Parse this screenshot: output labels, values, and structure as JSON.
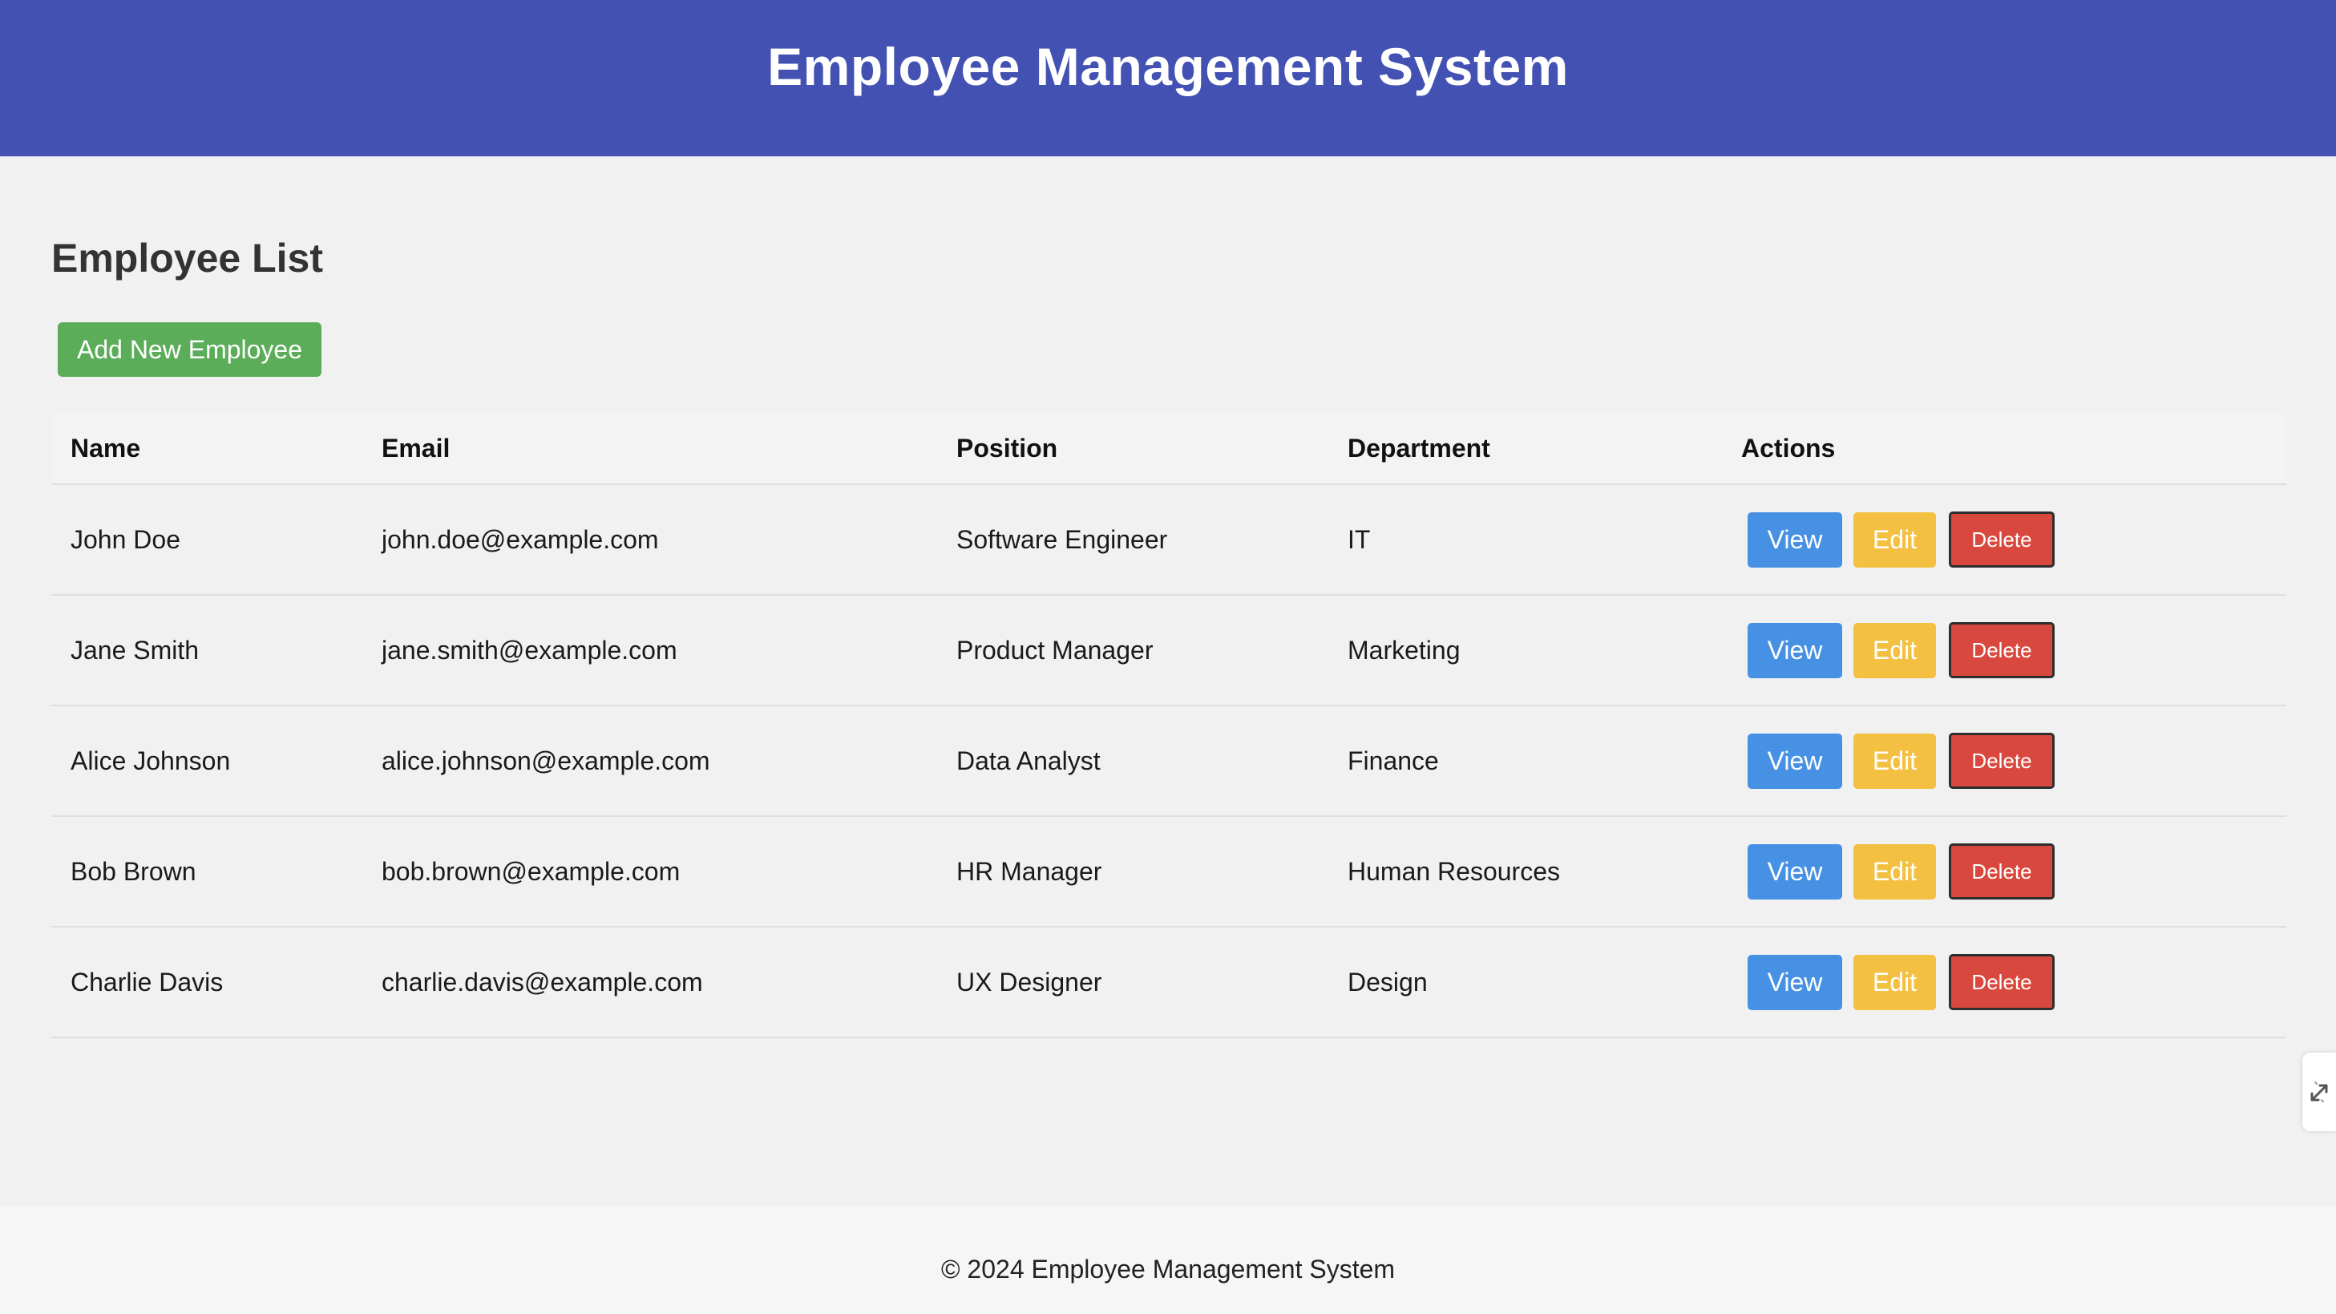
{
  "header": {
    "title": "Employee Management System"
  },
  "main": {
    "section_title": "Employee List",
    "add_button_label": "Add New Employee",
    "table": {
      "columns": [
        "Name",
        "Email",
        "Position",
        "Department",
        "Actions"
      ],
      "rows": [
        {
          "name": "John Doe",
          "email": "john.doe@example.com",
          "position": "Software Engineer",
          "department": "IT"
        },
        {
          "name": "Jane Smith",
          "email": "jane.smith@example.com",
          "position": "Product Manager",
          "department": "Marketing"
        },
        {
          "name": "Alice Johnson",
          "email": "alice.johnson@example.com",
          "position": "Data Analyst",
          "department": "Finance"
        },
        {
          "name": "Bob Brown",
          "email": "bob.brown@example.com",
          "position": "HR Manager",
          "department": "Human Resources"
        },
        {
          "name": "Charlie Davis",
          "email": "charlie.davis@example.com",
          "position": "UX Designer",
          "department": "Design"
        }
      ],
      "action_labels": {
        "view": "View",
        "edit": "Edit",
        "delete": "Delete"
      }
    }
  },
  "footer": {
    "text": "© 2024 Employee Management System"
  },
  "colors": {
    "header_bg": "#4352b2",
    "add_button": "#5cad5a",
    "view_button": "#4791e4",
    "edit_button": "#f4c042",
    "delete_button": "#d9483e"
  },
  "icons": {
    "side_handle": "expand-arrows-icon"
  }
}
